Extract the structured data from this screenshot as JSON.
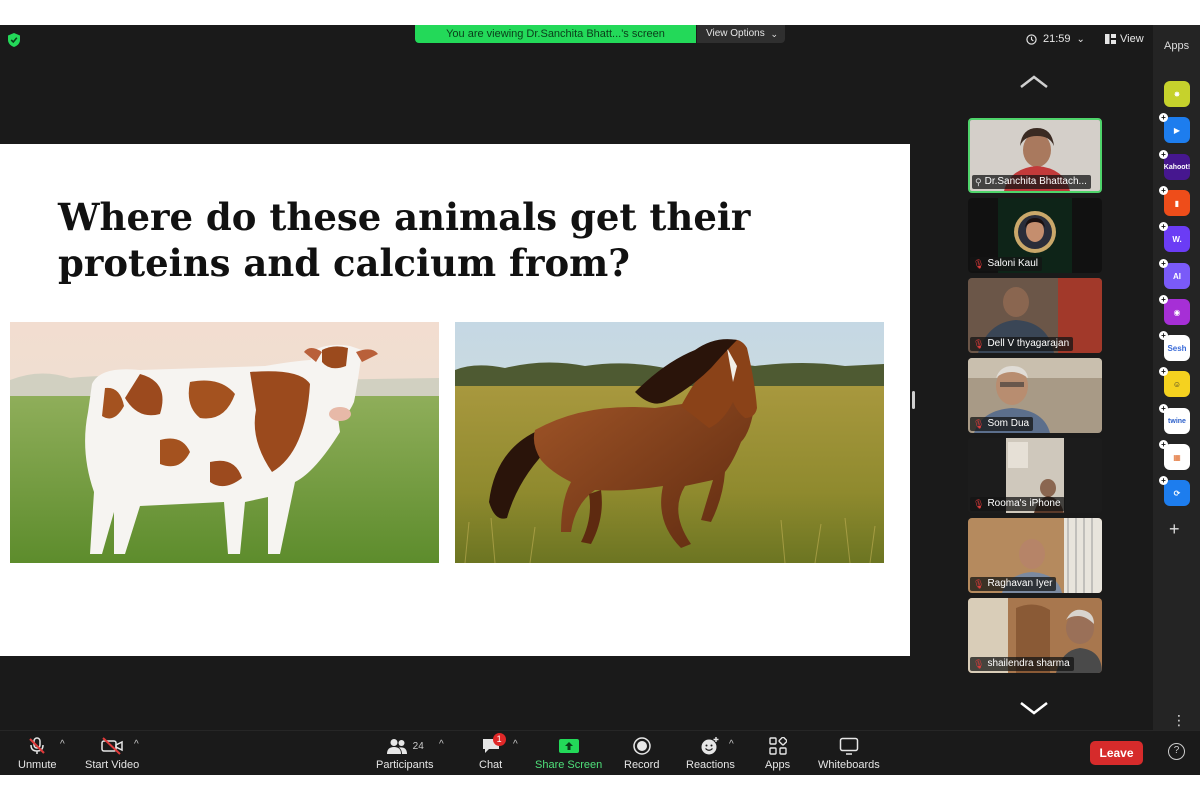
{
  "top_bar": {
    "share_banner": "You are viewing Dr.Sanchita Bhatt...'s screen",
    "view_options": "View Options",
    "clock": "21:59",
    "view_label": "View"
  },
  "slide": {
    "title_line1": "Where do these animals get their",
    "title_line2": "proteins and calcium from?"
  },
  "participants": [
    {
      "name": "Dr.Sanchita Bhattach...",
      "muted": false,
      "active": true
    },
    {
      "name": "Saloni Kaul",
      "muted": true
    },
    {
      "name": "Dell V thyagarajan",
      "muted": true
    },
    {
      "name": "Som Dua",
      "muted": true
    },
    {
      "name": "Rooma's iPhone",
      "muted": true
    },
    {
      "name": "Raghavan Iyer",
      "muted": true
    },
    {
      "name": "shailendra sharma",
      "muted": true
    }
  ],
  "apps_sidebar": {
    "label": "Apps",
    "apps": [
      {
        "icon": "sparkle-app-icon",
        "text": "✸",
        "bg": "#c6d22c",
        "fg": "#ffffff"
      },
      {
        "icon": "play-app-icon",
        "text": "▶",
        "bg": "#1d7dee",
        "fg": "#ffffff"
      },
      {
        "icon": "kahoot-app-icon",
        "text": "Kahoot!",
        "bg": "#46178f",
        "fg": "#ffffff"
      },
      {
        "icon": "orange-app-icon",
        "text": "▮",
        "bg": "#ee4d1a",
        "fg": "#ffffff"
      },
      {
        "icon": "w-app-icon",
        "text": "W.",
        "bg": "#6b3cf5",
        "fg": "#ffffff"
      },
      {
        "icon": "ai-app-icon",
        "text": "AI",
        "bg": "#7a5af8",
        "fg": "#ffffff"
      },
      {
        "icon": "camera-app-icon",
        "text": "◉",
        "bg": "#a62fd6",
        "fg": "#ffffff"
      },
      {
        "icon": "sesh-app-icon",
        "text": "Sesh",
        "bg": "#ffffff",
        "fg": "#3a6bd8"
      },
      {
        "icon": "smiley-app-icon",
        "text": "☺",
        "bg": "#f5d21f",
        "fg": "#2a2a2a"
      },
      {
        "icon": "twine-app-icon",
        "text": "twine",
        "bg": "#ffffff",
        "fg": "#2a5ec9"
      },
      {
        "icon": "grid-app-icon",
        "text": "▦",
        "bg": "#ffffff",
        "fg": "#e06a2a"
      },
      {
        "icon": "sync-app-icon",
        "text": "⟳",
        "bg": "#1d7dee",
        "fg": "#ffffff"
      }
    ]
  },
  "toolbar": {
    "unmute": "Unmute",
    "start_video": "Start Video",
    "participants": "Participants",
    "participants_count": "24",
    "chat": "Chat",
    "chat_badge": "1",
    "share_screen": "Share Screen",
    "record": "Record",
    "reactions": "Reactions",
    "apps": "Apps",
    "whiteboards": "Whiteboards",
    "leave": "Leave"
  },
  "colors": {
    "share_green": "#23d959",
    "leave_red": "#d62b2b",
    "active_speaker_border": "#4fd46b"
  }
}
